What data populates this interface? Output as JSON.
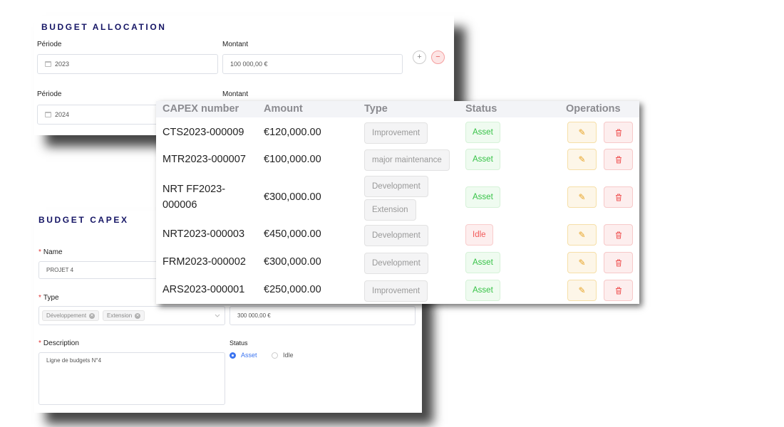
{
  "allocation": {
    "title": "BUDGET ALLOCATION",
    "rows": [
      {
        "period_label": "Période",
        "period_value": "2023",
        "amount_label": "Montant",
        "amount_value": "100 000,00 €"
      },
      {
        "period_label": "Période",
        "period_value": "2024",
        "amount_label": "Montant"
      }
    ],
    "add_symbol": "+",
    "remove_symbol": "−"
  },
  "capex_form": {
    "title": "BUDGET CAPEX",
    "required_marker": "*",
    "name_label": "Name",
    "name_value": "PROJET 4",
    "type_label": "Type",
    "type_tags": [
      "Développement",
      "Extension"
    ],
    "amount_value": "300 000,00 €",
    "description_label": "Description",
    "description_value": "Ligne de budgets N°4",
    "status_label": "Status",
    "status_options": [
      "Asset",
      "Idle"
    ],
    "status_selected": "Asset"
  },
  "table": {
    "columns": [
      "CAPEX number",
      "Amount",
      "Type",
      "Status",
      "Operations"
    ],
    "rows": [
      {
        "number": "CTS2023-000009",
        "amount": "€120,000.00",
        "types": [
          "Improvement"
        ],
        "status": "Asset"
      },
      {
        "number": "MTR2023-000007",
        "amount": "€100,000.00",
        "types": [
          "major maintenance"
        ],
        "status": "Asset"
      },
      {
        "number": "NRT FF2023-000006",
        "amount": "€300,000.00",
        "types": [
          "Development",
          "Extension"
        ],
        "status": "Asset"
      },
      {
        "number": "NRT2023-000003",
        "amount": "€450,000.00",
        "types": [
          "Development"
        ],
        "status": "Idle"
      },
      {
        "number": "FRM2023-000002",
        "amount": "€300,000.00",
        "types": [
          "Development"
        ],
        "status": "Asset"
      },
      {
        "number": "ARS2023-000001",
        "amount": "€250,000.00",
        "types": [
          "Improvement"
        ],
        "status": "Asset"
      }
    ]
  },
  "icons": {
    "edit": "pencil-icon",
    "delete": "trash-icon",
    "period": "calendar-icon",
    "type_dropdown": "chevron-down-icon"
  },
  "colors": {
    "title": "#151565",
    "asset": "#38c348",
    "idle": "#f25a5a",
    "edit": "#e7a325",
    "delete": "#f05b5b",
    "radio": "#3b74f0"
  }
}
